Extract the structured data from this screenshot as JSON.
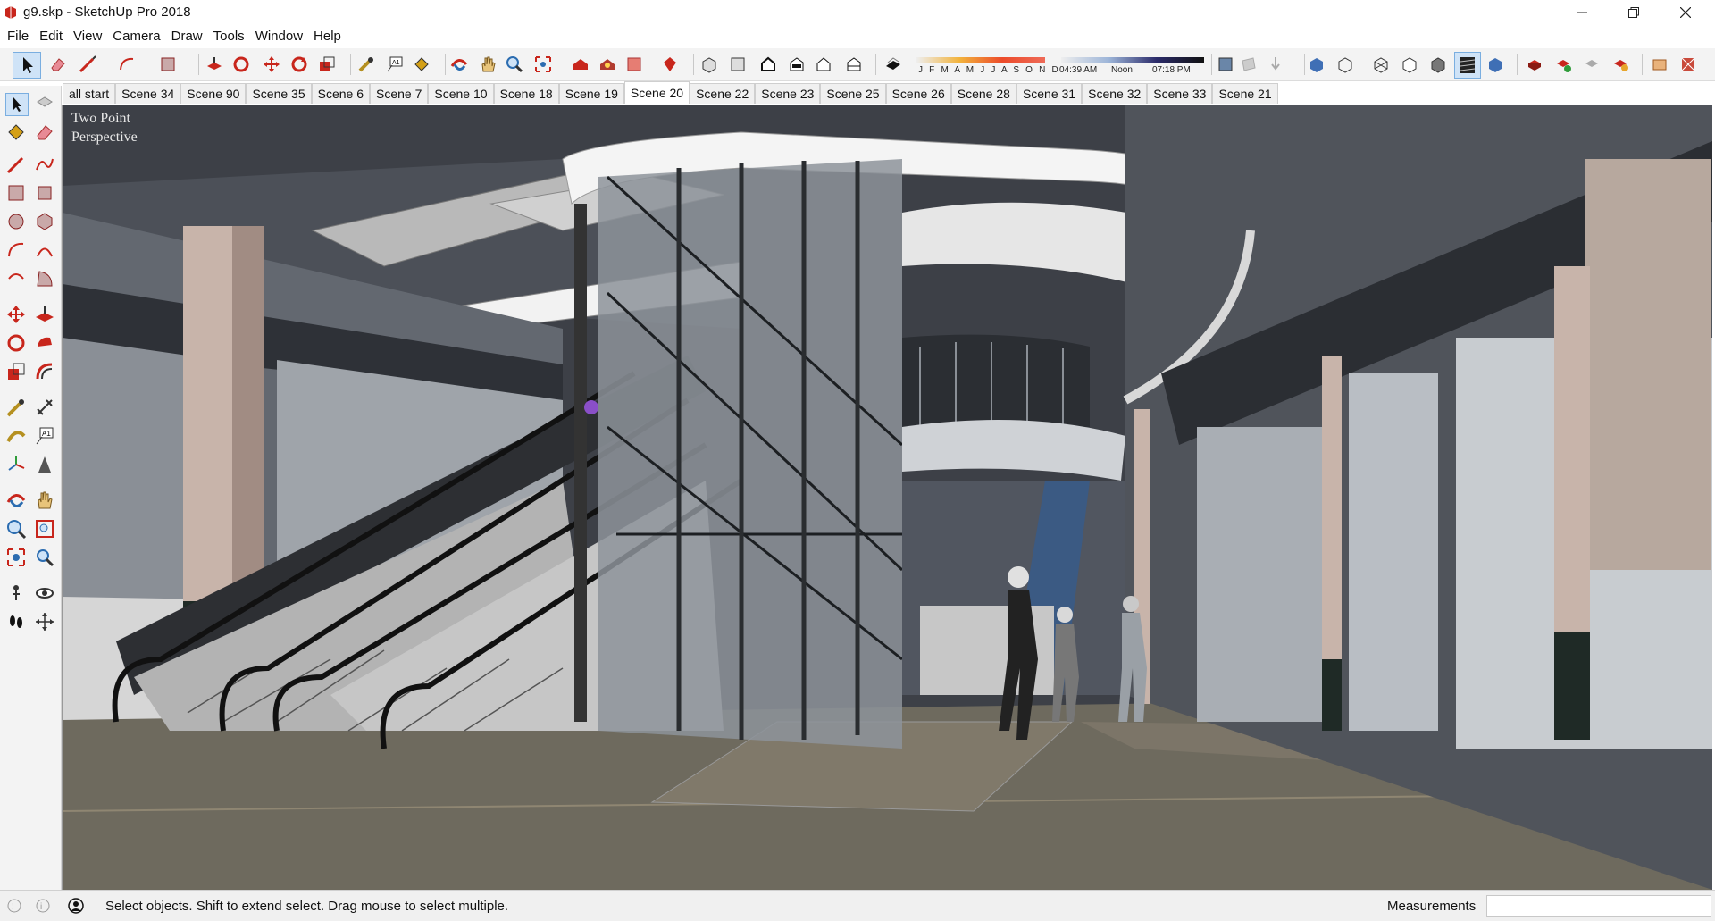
{
  "window": {
    "title": "g9.skp - SketchUp Pro 2018",
    "app_icon": "sketchup-logo-icon",
    "controls": [
      "minimize-icon",
      "restore-icon",
      "close-icon"
    ]
  },
  "menu": [
    "File",
    "Edit",
    "View",
    "Camera",
    "Draw",
    "Tools",
    "Window",
    "Help"
  ],
  "shadow_widget": {
    "months": "J F M A M J J A S O N D",
    "time_start": "04:39 AM",
    "time_mid": "Noon",
    "time_end": "07:18 PM"
  },
  "scenes": {
    "tabs": [
      "all start",
      "Scene 34",
      "Scene 90",
      "Scene 35",
      "Scene 6",
      "Scene 7",
      "Scene 10",
      "Scene 18",
      "Scene 19",
      "Scene 20",
      "Scene 22",
      "Scene 23",
      "Scene 25",
      "Scene 26",
      "Scene 28",
      "Scene 31",
      "Scene 32",
      "Scene 33",
      "Scene 21"
    ],
    "active": "Scene 20"
  },
  "viewport": {
    "camera_label_line1": "Two Point",
    "camera_label_line2": "Perspective"
  },
  "status": {
    "hint": "Select objects. Shift to extend select. Drag mouse to select multiple.",
    "measurements_label": "Measurements",
    "measurements_value": ""
  },
  "colors": {
    "accent_red": "#c8261c",
    "sky": "#3b3e44",
    "floor": "#6e6a5e"
  }
}
